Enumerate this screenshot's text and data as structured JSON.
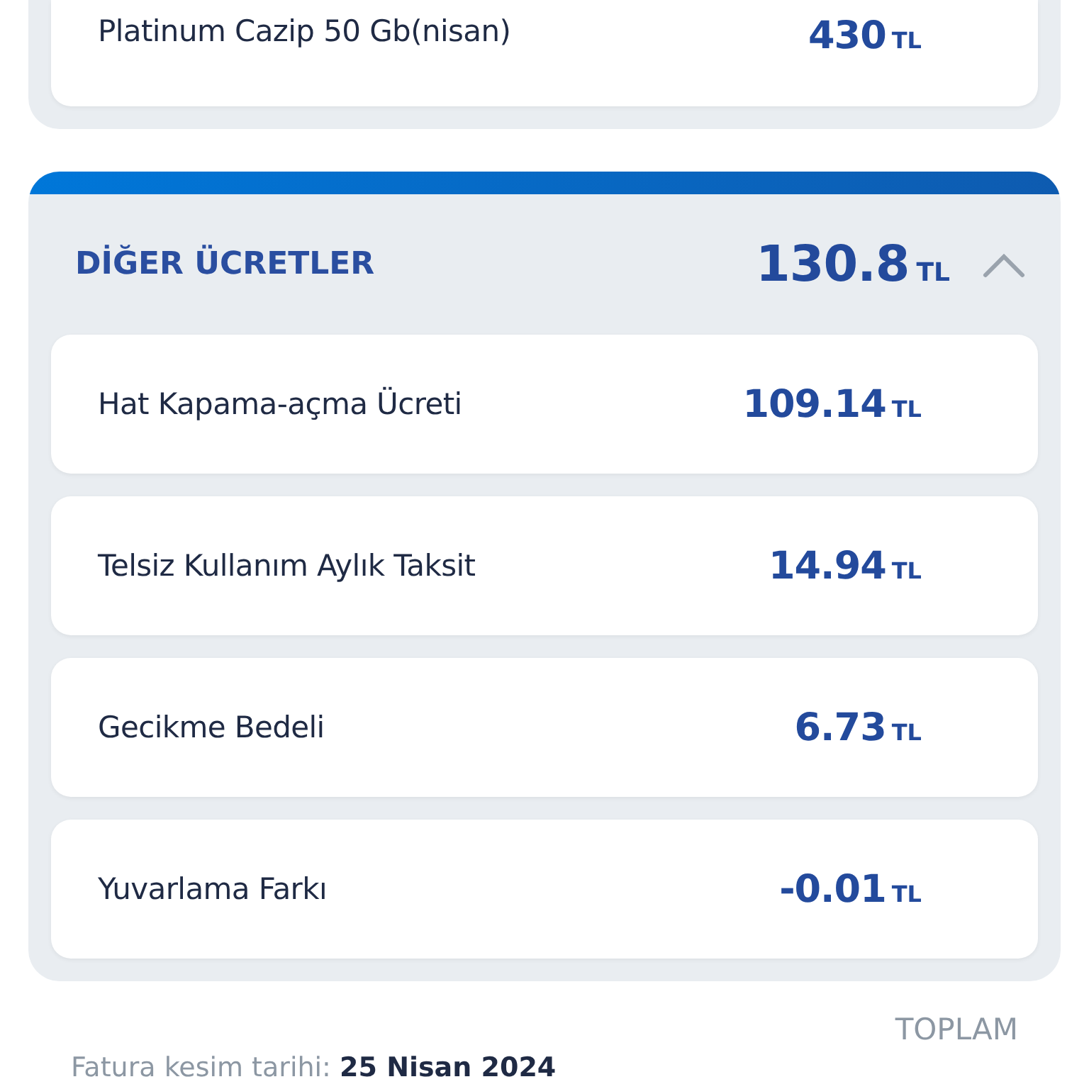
{
  "previous_section": {
    "items": [
      {
        "name": "Platinum Cazip 50 Gb(nisan)",
        "amount": "430",
        "currency": "TL"
      }
    ]
  },
  "section": {
    "title": "DİĞER ÜCRETLER",
    "amount": "130.8",
    "currency": "TL",
    "expanded": true,
    "items": [
      {
        "name": "Hat Kapama-açma Ücreti",
        "amount": "109.14",
        "currency": "TL"
      },
      {
        "name": "Telsiz Kullanım Aylık Taksit",
        "amount": "14.94",
        "currency": "TL"
      },
      {
        "name": "Gecikme Bedeli",
        "amount": "6.73",
        "currency": "TL"
      },
      {
        "name": "Yuvarlama Farkı",
        "amount": "-0.01",
        "currency": "TL"
      }
    ]
  },
  "footer": {
    "total_label": "TOPLAM",
    "date_label": "Fatura kesim tarihi:",
    "date_value": "25 Nisan 2024"
  }
}
